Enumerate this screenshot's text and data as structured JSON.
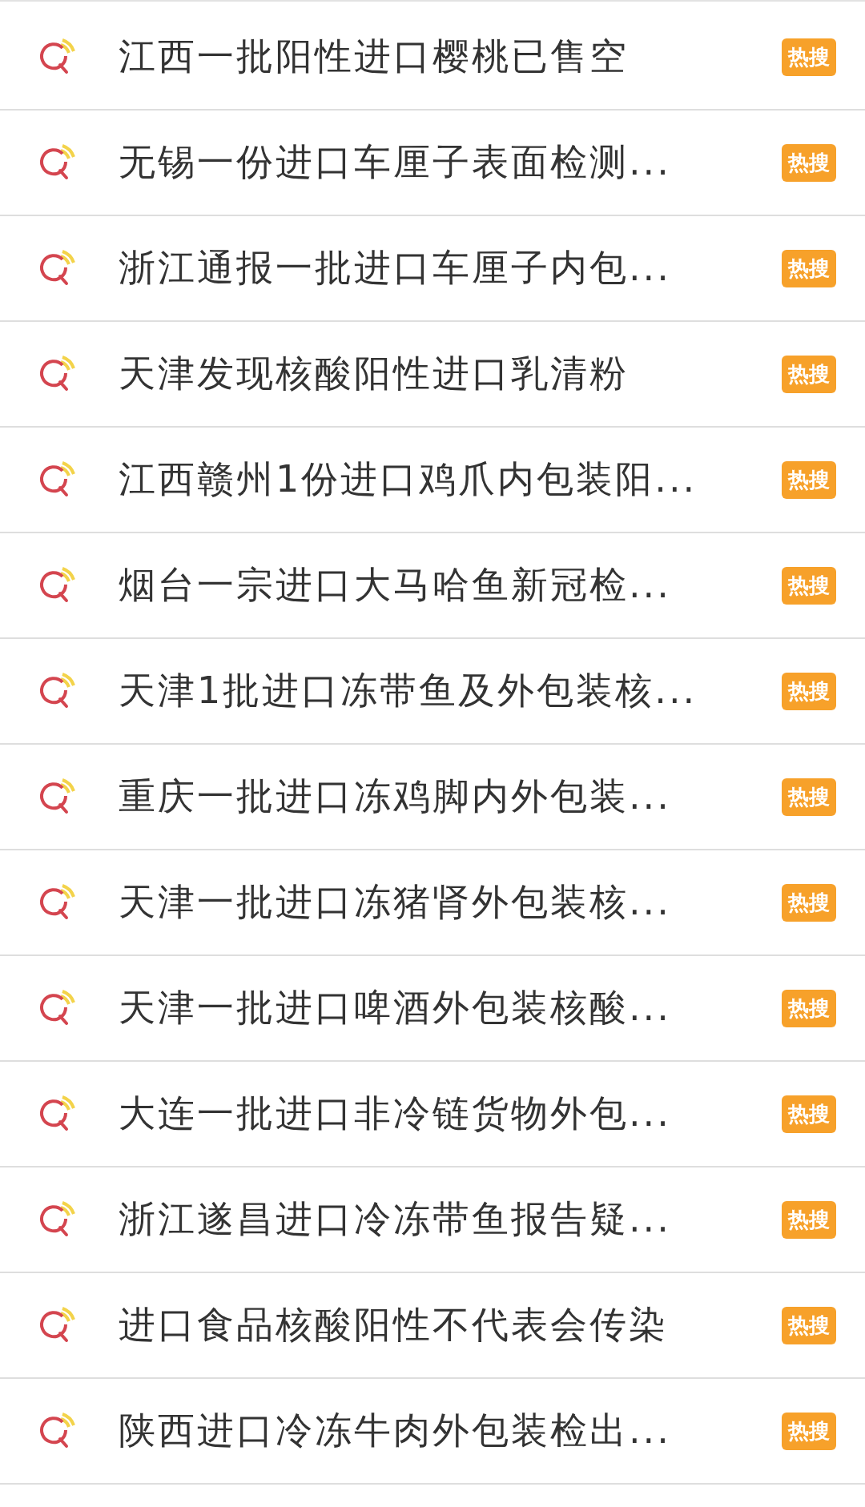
{
  "items": [
    {
      "title": "江西一批阳性进口樱桃已售空",
      "badge": "热搜"
    },
    {
      "title": "无锡一份进口车厘子表面检测...",
      "badge": "热搜"
    },
    {
      "title": "浙江通报一批进口车厘子内包...",
      "badge": "热搜"
    },
    {
      "title": "天津发现核酸阳性进口乳清粉",
      "badge": "热搜"
    },
    {
      "title": "江西赣州1份进口鸡爪内包装阳...",
      "badge": "热搜"
    },
    {
      "title": "烟台一宗进口大马哈鱼新冠检...",
      "badge": "热搜"
    },
    {
      "title": "天津1批进口冻带鱼及外包装核...",
      "badge": "热搜"
    },
    {
      "title": "重庆一批进口冻鸡脚内外包装...",
      "badge": "热搜"
    },
    {
      "title": "天津一批进口冻猪肾外包装核...",
      "badge": "热搜"
    },
    {
      "title": "天津一批进口啤酒外包装核酸...",
      "badge": "热搜"
    },
    {
      "title": "大连一批进口非冷链货物外包...",
      "badge": "热搜"
    },
    {
      "title": "浙江遂昌进口冷冻带鱼报告疑...",
      "badge": "热搜"
    },
    {
      "title": "进口食品核酸阳性不代表会传染",
      "badge": "热搜"
    },
    {
      "title": "陕西进口冷冻牛肉外包装检出...",
      "badge": "热搜"
    }
  ]
}
